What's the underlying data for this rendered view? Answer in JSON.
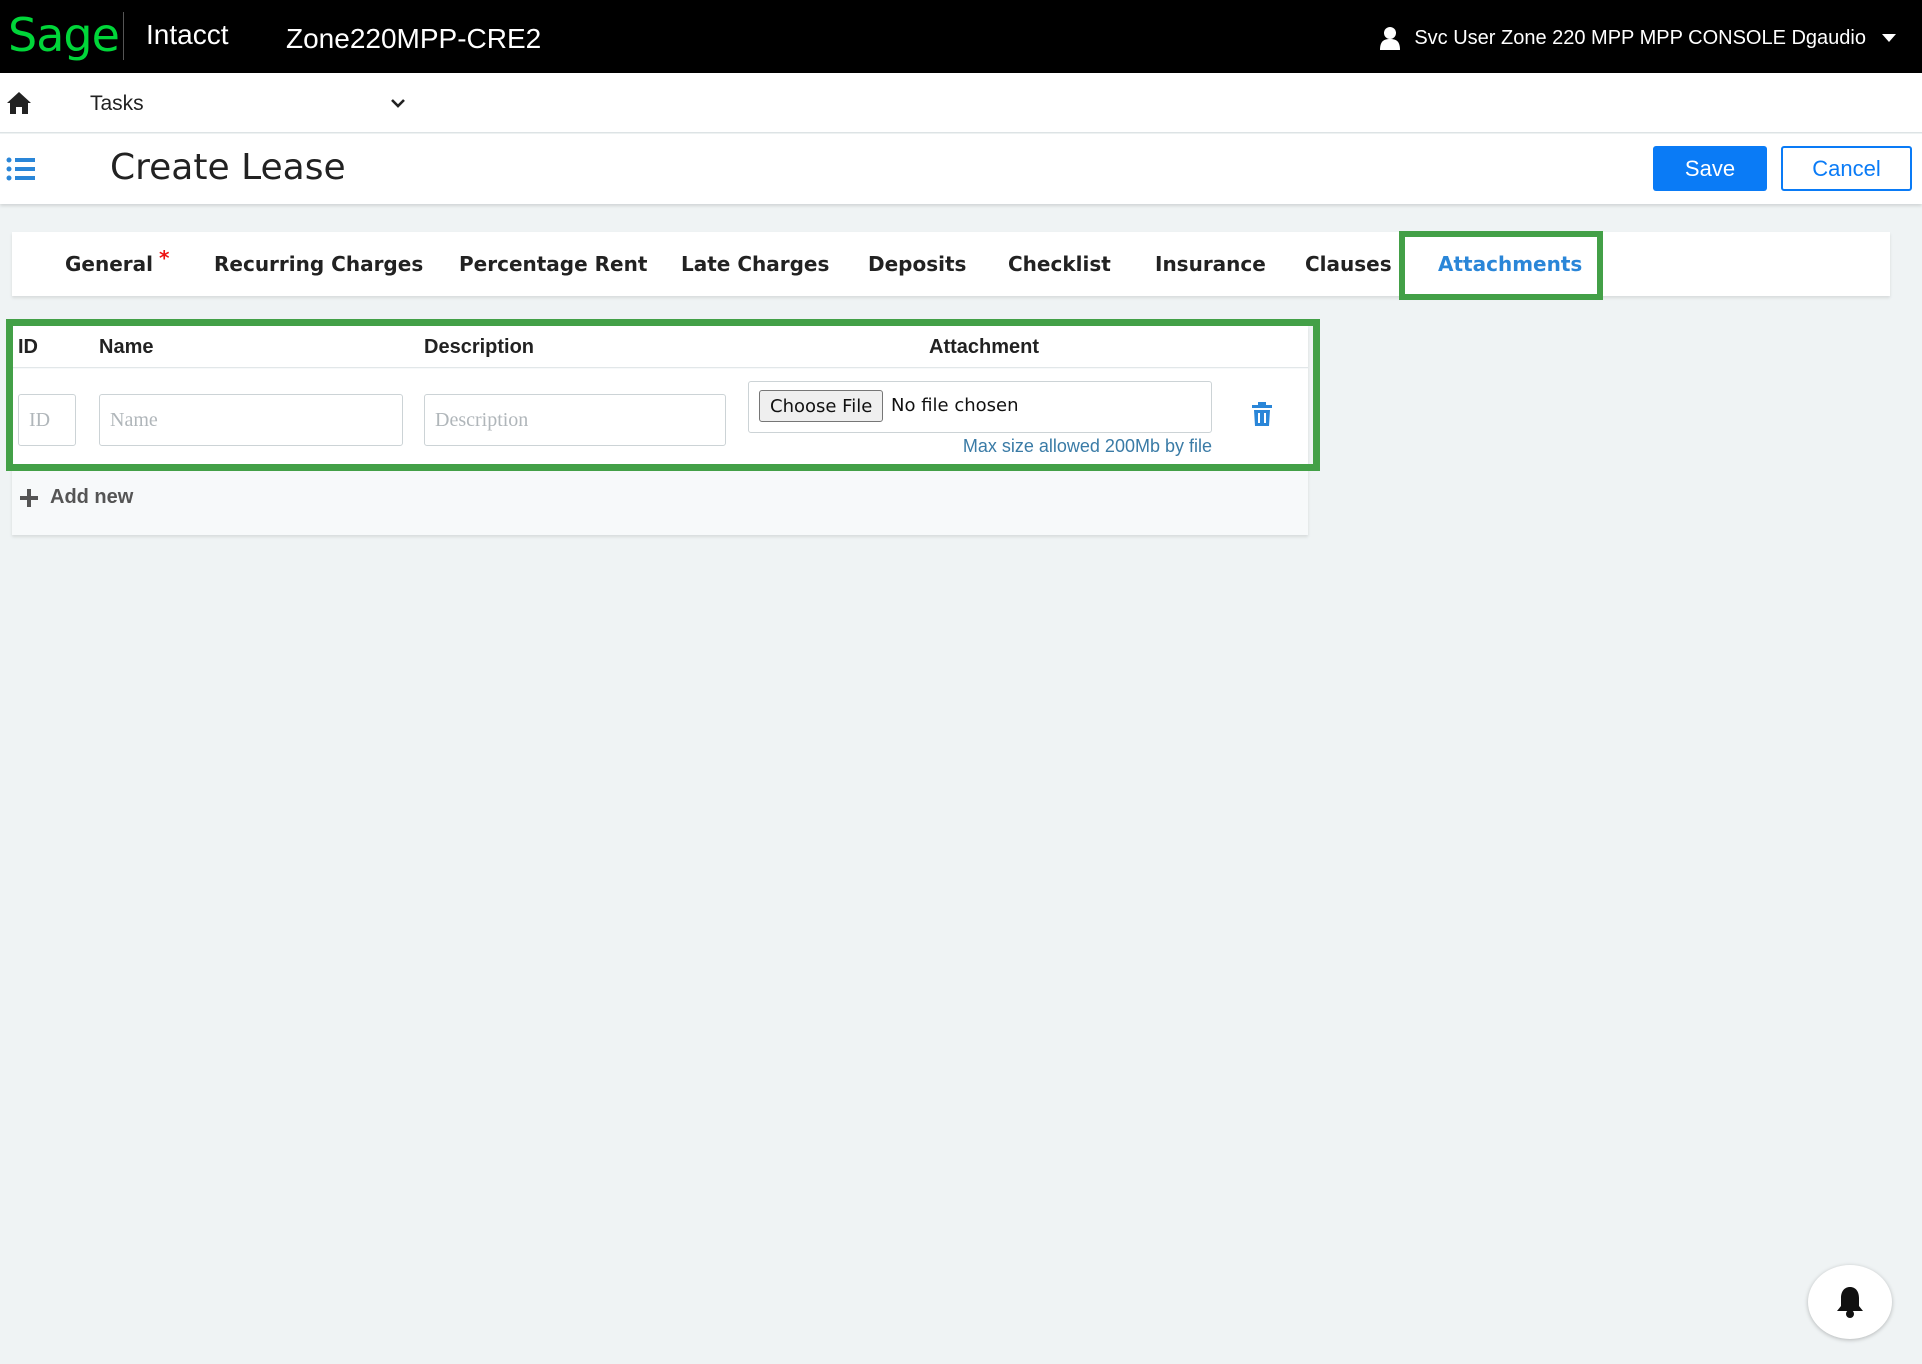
{
  "topbar": {
    "logo": "Sage",
    "product": "Intacct",
    "company": "Zone220MPP-CRE2",
    "user_name": "Svc User Zone 220 MPP MPP CONSOLE Dgaudio",
    "user_icon": "user-icon",
    "menu_icon": "caret-down-icon"
  },
  "nav": {
    "home_icon": "home-icon",
    "menu_label": "Tasks",
    "menu_icon": "chevron-down-icon"
  },
  "header": {
    "list_icon": "list-icon",
    "title": "Create Lease",
    "save_label": "Save",
    "cancel_label": "Cancel"
  },
  "tabs": [
    {
      "label": "General",
      "required_mark": "*"
    },
    {
      "label": "Recurring Charges"
    },
    {
      "label": "Percentage Rent"
    },
    {
      "label": "Late Charges"
    },
    {
      "label": "Deposits"
    },
    {
      "label": "Checklist"
    },
    {
      "label": "Insurance"
    },
    {
      "label": "Clauses"
    },
    {
      "label": "Attachments",
      "active": true
    }
  ],
  "attachments": {
    "columns": [
      "ID",
      "Name",
      "Description",
      "Attachment"
    ],
    "row": {
      "id_placeholder": "ID",
      "name_placeholder": "Name",
      "description_placeholder": "Description",
      "choose_file_label": "Choose File",
      "file_status": "No file chosen",
      "max_size_note": "Max size allowed 200Mb by file",
      "delete_icon": "trash-icon"
    },
    "add_new_label": "Add new",
    "add_new_icon": "plus-icon"
  },
  "notifications": {
    "icon": "bell-icon"
  },
  "colors": {
    "brand_green": "#00d639",
    "primary_blue": "#0a7bf6",
    "active_tab": "#2a86d8",
    "highlight_green": "#43a047",
    "required_red": "#e11"
  }
}
